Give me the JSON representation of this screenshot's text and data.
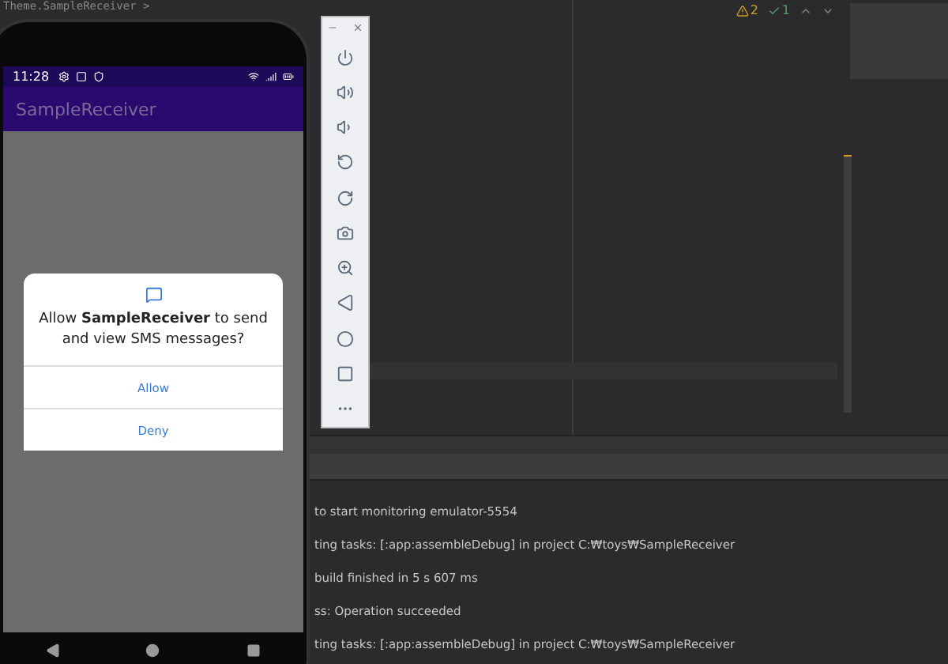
{
  "editor": {
    "breadcrumb": "Theme.SampleReceiver >",
    "warnings": "2",
    "checks": "1"
  },
  "phone": {
    "time": "11:28",
    "app_title": "SampleReceiver",
    "dialog": {
      "message": "Allow **SampleReceiver** to send and view SMS messages?",
      "buttons": [
        "Allow",
        "Deny"
      ]
    }
  },
  "log": [
    "to start monitoring emulator-5554",
    "ting tasks: [:app:assembleDebug] in project C:₩toys₩SampleReceiver",
    "build finished in 5 s 607 ms",
    "ss: Operation succeeded",
    "ting tasks: [:app:assembleDebug] in project C:₩toys₩SampleReceiver"
  ]
}
